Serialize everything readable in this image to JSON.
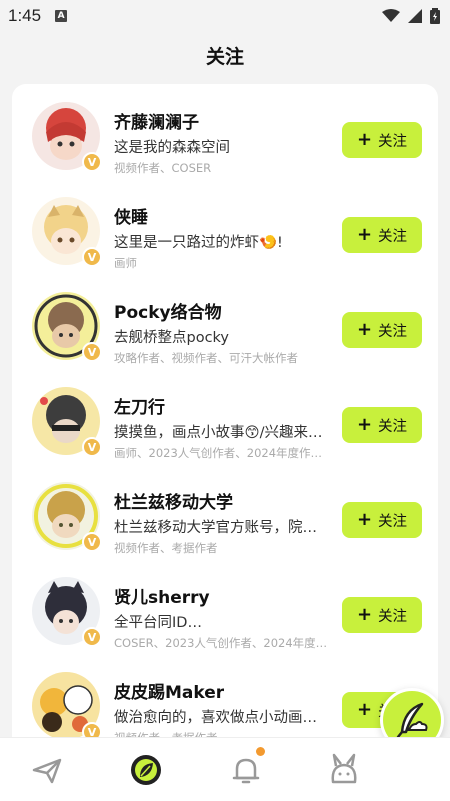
{
  "status_bar": {
    "time": "1:45",
    "notif_letter": "A"
  },
  "page_title": "关注",
  "follow_label": "关注",
  "badge_symbol": "V",
  "users": [
    {
      "name": "齐藤澜澜子",
      "bio": "这是我的森森空间",
      "tags": "视频作者、COSER",
      "avatar_color": "#d6453d"
    },
    {
      "name": "侠睡",
      "bio": "这里是一只路过的炸虾🍤!",
      "tags": "画师",
      "avatar_color": "#f2d38a"
    },
    {
      "name": "Pocky络合物",
      "bio": "去舰桥整点pocky",
      "tags": "攻略作者、视频作者、可汗大帐作者",
      "avatar_color": "#8a6a4f"
    },
    {
      "name": "左刀行",
      "bio": "摸摸鱼，画点小故事😙/兴趣来…",
      "tags": "画师、2023人气创作者、2024年度作…",
      "avatar_color": "#3d3d3d"
    },
    {
      "name": "杜兰兹移动大学",
      "bio": "杜兰兹移动大学官方账号，院…",
      "tags": "视频作者、考据作者",
      "avatar_color": "#c9a24a"
    },
    {
      "name": "贤儿sherry",
      "bio": "全平台同ID…",
      "tags": "COSER、2023人气创作者、2024年度…",
      "avatar_color": "#2e2e3a"
    },
    {
      "name": "皮皮踢Maker",
      "bio": "做治愈向的，喜欢做点小动画…",
      "tags": "视频作者、考据作者",
      "avatar_color": "#f1b63b"
    }
  ],
  "colors": {
    "accent": "#c8f03c",
    "badge": "#f0b94b",
    "notif_dot": "#f39a2f"
  }
}
